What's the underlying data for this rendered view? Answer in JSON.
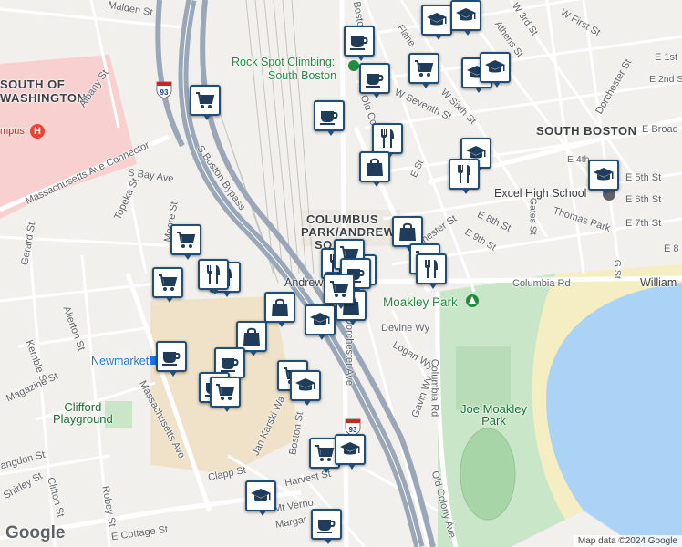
{
  "map": {
    "attribution": "Map data ©2024 Google",
    "logo": "Google",
    "colors": {
      "land": "#f2f0ec",
      "water": "#aad3f5",
      "park": "#c9e6c9",
      "highway": "#9aa7b8",
      "marker_border": "#1f4e79",
      "hospital_area": "#f7d0cf",
      "sand": "#f5eec2"
    }
  },
  "labels": {
    "malden_st": "Malden St",
    "south_of": "SOUTH OF",
    "washington": "WASHINGTON",
    "albany_st": "Albany St",
    "campus": "mpus",
    "mass_ave_connector": "Massachusetts Ave Connector",
    "s_boston_bypass": "S Boston Bypass",
    "s_bay_ave": "S Bay Ave",
    "topeka_st": "Topeka St",
    "moore_st": "Moore St",
    "gerard_st": "Gerard St",
    "allerton_st": "Allerton St",
    "kemble_st": "Kemble St",
    "magazine_st": "Magazine St",
    "newmarket": "Newmarket",
    "clifford_playground": "Clifford\nPlayground",
    "mass_ave": "Massachusetts Ave",
    "langdon_st": "angdon St",
    "shirley_st": "Shirley St",
    "clifton_st": "Clifton St",
    "robey_st": "Robey St",
    "e_cottage_st": "E Cottage St",
    "clapp_st": "Clapp St",
    "harvest_st": "Harvest St",
    "mt_vernon": "Mt Verno",
    "margaret": "Margar",
    "jan_karski": "Jan Karski Wa",
    "boston_st": "Boston St",
    "dorchester_ave": "Dorchester Ave",
    "andrew": "Andrew",
    "columbus_park": "COLUMBUS",
    "columbus_park2": "PARK/ANDREW",
    "columbus_park3": "SQ",
    "rock_spot": "Rock Spot Climbing:",
    "rock_spot2": "South Boston",
    "s_boston_top": "S Boston",
    "old_colony_top": "Old Colony",
    "w_seventh_st": "W Seventh St",
    "flaherty": "Flahe",
    "athens_st": "Athens St",
    "w_3rd_st": "W 3rd St",
    "w_first_st": "W First St",
    "e_1st": "E 1st",
    "e_2nd_s": "E 2nd S",
    "w_sixth_st": "W Sixth St",
    "south_boston": "SOUTH BOSTON",
    "e_broad": "E Broad",
    "dorchester_st": "Dorchester St",
    "e_4th": "E 4th",
    "e_5th_st": "E 5th St",
    "e_6th_st": "E 6th St",
    "e_7th_st": "E 7th St",
    "e_8": "E 8",
    "excel_high": "Excel High School",
    "thomas_park": "Thomas Park",
    "gates_st": "Gates St",
    "g_st": "G St",
    "e_8th_st": "E 8th St",
    "e_9th_st": "E 9th St",
    "e_st": "E St",
    "c_st": "C St",
    "chester_st": "chester St",
    "columbia_rd": "Columbia Rd",
    "william": "William",
    "moakley_park": "Moakley Park",
    "devine_wy": "Devine Wy",
    "logan_wy": "Logan Wy",
    "gavin_wy": "Gavin Wy",
    "columbia_rd_vertical": "Columbia Rd",
    "joe_moakley": "Joe Moakley\nPark",
    "old_colony_ave": "Old Colony Ave",
    "i93": "93"
  },
  "markers": [
    {
      "type": "school",
      "icon": "graduation-cap-icon"
    },
    {
      "type": "school",
      "icon": "graduation-cap-icon"
    },
    {
      "type": "cafe",
      "icon": "coffee-cup-icon"
    },
    {
      "type": "grocery",
      "icon": "shopping-cart-icon"
    },
    {
      "type": "school",
      "icon": "graduation-cap-icon"
    },
    {
      "type": "school",
      "icon": "graduation-cap-icon"
    },
    {
      "type": "cafe",
      "icon": "coffee-cup-icon"
    },
    {
      "type": "grocery",
      "icon": "shopping-cart-icon"
    },
    {
      "type": "cafe",
      "icon": "coffee-cup-icon"
    },
    {
      "type": "restaurant",
      "icon": "fork-knife-icon"
    },
    {
      "type": "shopping",
      "icon": "shopping-bag-icon"
    },
    {
      "type": "school",
      "icon": "graduation-cap-icon"
    },
    {
      "type": "restaurant",
      "icon": "fork-knife-icon"
    },
    {
      "type": "school",
      "icon": "graduation-cap-icon"
    },
    {
      "type": "shopping",
      "icon": "shopping-bag-icon"
    },
    {
      "type": "grocery",
      "icon": "shopping-cart-icon"
    },
    {
      "type": "restaurant",
      "icon": "fork-knife-icon"
    },
    {
      "type": "grocery",
      "icon": "shopping-cart-icon"
    },
    {
      "type": "restaurant",
      "icon": "fork-knife-icon"
    },
    {
      "type": "grocery",
      "icon": "shopping-cart-icon"
    },
    {
      "type": "restaurant",
      "icon": "fork-knife-icon"
    },
    {
      "type": "shopping",
      "icon": "shopping-bag-icon"
    },
    {
      "type": "cafe",
      "icon": "coffee-cup-icon"
    },
    {
      "type": "restaurant",
      "icon": "fork-knife-icon"
    },
    {
      "type": "grocery",
      "icon": "shopping-cart-icon"
    },
    {
      "type": "restaurant",
      "icon": "fork-knife-icon"
    },
    {
      "type": "cafe",
      "icon": "coffee-cup-icon"
    },
    {
      "type": "shopping",
      "icon": "shopping-bag-icon"
    },
    {
      "type": "school",
      "icon": "graduation-cap-icon"
    },
    {
      "type": "shopping",
      "icon": "shopping-bag-icon"
    },
    {
      "type": "grocery",
      "icon": "shopping-cart-icon"
    },
    {
      "type": "cafe",
      "icon": "coffee-cup-icon"
    },
    {
      "type": "cafe",
      "icon": "coffee-cup-icon"
    },
    {
      "type": "cafe",
      "icon": "coffee-cup-icon"
    },
    {
      "type": "grocery",
      "icon": "shopping-cart-icon"
    },
    {
      "type": "grocery",
      "icon": "shopping-cart-icon"
    },
    {
      "type": "school",
      "icon": "graduation-cap-icon"
    },
    {
      "type": "grocery",
      "icon": "shopping-cart-icon"
    },
    {
      "type": "school",
      "icon": "graduation-cap-icon"
    },
    {
      "type": "school",
      "icon": "graduation-cap-icon"
    },
    {
      "type": "cafe",
      "icon": "coffee-cup-icon"
    }
  ]
}
